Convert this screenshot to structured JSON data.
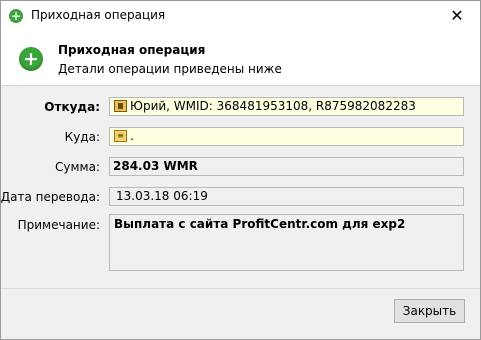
{
  "window": {
    "title": "Приходная операция",
    "close_glyph": "✕",
    "title_icon": "plus-circle-icon"
  },
  "header": {
    "title": "Приходная операция",
    "subtitle": "Детали операции приведены ниже",
    "icon": "plus-circle-icon"
  },
  "form": {
    "from": {
      "label": "Откуда:",
      "value": "Юрий, WMID: 368481953108, R875982082283",
      "icon": "wallet-icon"
    },
    "to": {
      "label": "Куда:",
      "value": ".",
      "icon": "contact-card-icon"
    },
    "amount": {
      "label": "Сумма:",
      "value": "284.03 WMR"
    },
    "date": {
      "label": "Дата перевода:",
      "value": "13.03.18 06:19"
    },
    "note": {
      "label": "Примечание:",
      "value": "Выплата с сайта ProfitCentr.com для exp2"
    }
  },
  "buttons": {
    "close": "Закрыть"
  },
  "colors": {
    "accent_green": "#3aa53a",
    "field_highlight": "#ffffe1",
    "window_bg": "#f0f0f0"
  }
}
